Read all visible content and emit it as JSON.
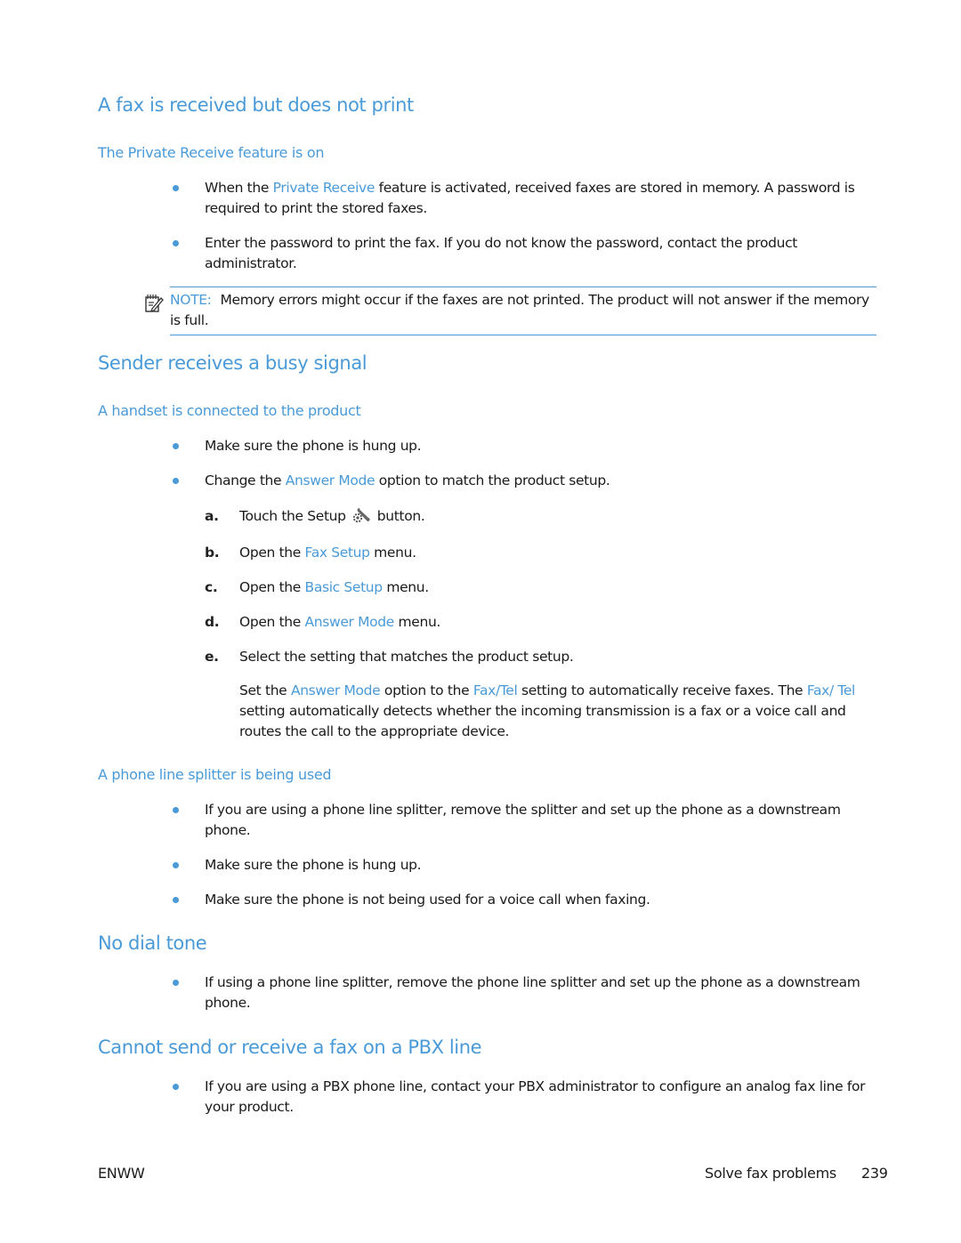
{
  "sections": [
    {
      "title": "A fax is received but does not print",
      "subsections": [
        {
          "title": "The Private Receive feature is on",
          "bullets": [
            {
              "pre": "When the ",
              "link": "Private Receive",
              "post": " feature is activated, received faxes are stored in memory. A password is required to print the stored faxes."
            },
            {
              "text": "Enter the password to print the fax. If you do not know the password, contact the product administrator."
            }
          ],
          "note": {
            "label": "NOTE:",
            "text": "Memory errors might occur if the faxes are not printed. The product will not answer if the memory is full.",
            "icon": "note-pencil-icon"
          }
        }
      ]
    },
    {
      "title": "Sender receives a busy signal",
      "subsections": [
        {
          "title": "A handset is connected to the product",
          "bullets": [
            {
              "text": "Make sure the phone is hung up."
            },
            {
              "pre": "Change the ",
              "link": "Answer Mode",
              "post": " option to match the product setup."
            }
          ],
          "steps": [
            {
              "label": "a.",
              "pre": "Touch the Setup ",
              "icon": "setup-wrench-gear-icon",
              "post": " button."
            },
            {
              "label": "b.",
              "pre": "Open the ",
              "link": "Fax Setup",
              "post": " menu."
            },
            {
              "label": "c.",
              "pre": "Open the ",
              "link": "Basic Setup",
              "post": " menu."
            },
            {
              "label": "d.",
              "pre": "Open the ",
              "link": "Answer Mode",
              "post": " menu."
            },
            {
              "label": "e.",
              "text": "Select the setting that matches the product setup."
            }
          ],
          "step_detail": {
            "p1": "Set the ",
            "l1": "Answer Mode",
            "p2": " option to the ",
            "l2": "Fax/Tel",
            "p3": " setting to automatically receive faxes. The ",
            "l3": "Fax/ Tel",
            "p4": " setting automatically detects whether the incoming transmission is a fax or a voice call and routes the call to the appropriate device."
          }
        },
        {
          "title": "A phone line splitter is being used",
          "bullets": [
            {
              "text": "If you are using a phone line splitter, remove the splitter and set up the phone as a downstream phone."
            },
            {
              "text": "Make sure the phone is hung up."
            },
            {
              "text": "Make sure the phone is not being used for a voice call when faxing."
            }
          ]
        }
      ]
    },
    {
      "title": "No dial tone",
      "bullets": [
        {
          "text": "If using a phone line splitter, remove the phone line splitter and set up the phone as a downstream phone."
        }
      ]
    },
    {
      "title": "Cannot send or receive a fax on a PBX line",
      "bullets": [
        {
          "text": "If you are using a PBX phone line, contact your PBX administrator to configure an analog fax line for your product."
        }
      ]
    }
  ],
  "footer": {
    "left": "ENWW",
    "section": "Solve fax problems",
    "page_number": "239"
  },
  "colors": {
    "accent": "#4a9ad8",
    "text": "#1a1a1a"
  }
}
